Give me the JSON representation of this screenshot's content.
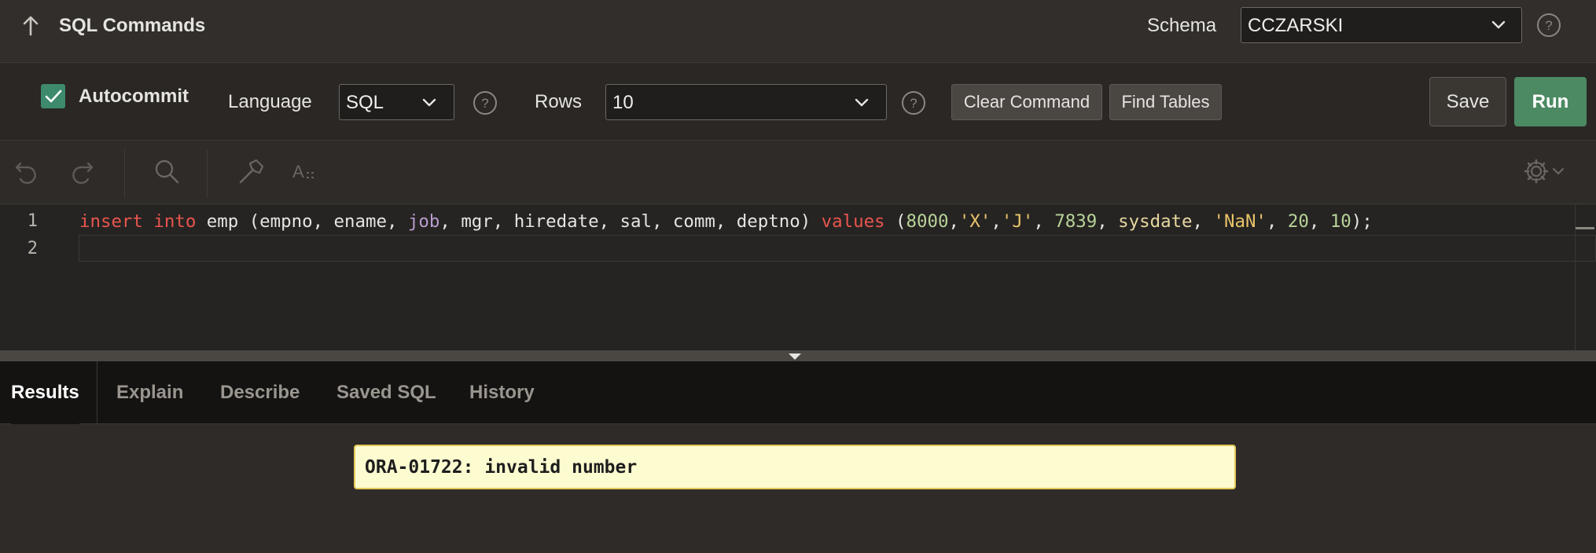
{
  "header": {
    "title": "SQL Commands",
    "schema_label": "Schema",
    "schema_value": "CCZARSKI"
  },
  "toolbar": {
    "autocommit_label": "Autocommit",
    "autocommit_checked": true,
    "language_label": "Language",
    "language_value": "SQL",
    "rows_label": "Rows",
    "rows_value": "10",
    "clear_label": "Clear Command",
    "find_tables_label": "Find Tables",
    "save_label": "Save",
    "run_label": "Run"
  },
  "editor_toolbar": {
    "icons": [
      "undo-icon",
      "redo-icon",
      "search-icon",
      "hammer-icon",
      "text-format-icon",
      "gear-icon"
    ]
  },
  "editor": {
    "line_numbers": [
      "1",
      "2"
    ],
    "tokens": [
      {
        "t": "insert",
        "c": "kw"
      },
      {
        "t": " ",
        "c": ""
      },
      {
        "t": "into",
        "c": "kw"
      },
      {
        "t": " emp (empno, ename, ",
        "c": ""
      },
      {
        "t": "job",
        "c": "fn"
      },
      {
        "t": ", mgr, hiredate, sal, comm, deptno) ",
        "c": ""
      },
      {
        "t": "values",
        "c": "kw"
      },
      {
        "t": " (",
        "c": ""
      },
      {
        "t": "8000",
        "c": "num"
      },
      {
        "t": ",",
        "c": ""
      },
      {
        "t": "'X'",
        "c": "str"
      },
      {
        "t": ",",
        "c": ""
      },
      {
        "t": "'J'",
        "c": "str"
      },
      {
        "t": ", ",
        "c": ""
      },
      {
        "t": "7839",
        "c": "num"
      },
      {
        "t": ", ",
        "c": ""
      },
      {
        "t": "sysdate",
        "c": "sysfn"
      },
      {
        "t": ", ",
        "c": ""
      },
      {
        "t": "'NaN'",
        "c": "str"
      },
      {
        "t": ", ",
        "c": ""
      },
      {
        "t": "20",
        "c": "num"
      },
      {
        "t": ", ",
        "c": ""
      },
      {
        "t": "10",
        "c": "num"
      },
      {
        "t": ");",
        "c": ""
      }
    ]
  },
  "tabs": [
    {
      "label": "Results",
      "active": true
    },
    {
      "label": "Explain",
      "active": false
    },
    {
      "label": "Describe",
      "active": false
    },
    {
      "label": "Saved SQL",
      "active": false
    },
    {
      "label": "History",
      "active": false
    }
  ],
  "results": {
    "error_message": "ORA-01722: invalid number"
  },
  "colors": {
    "run_button": "#4b8a62",
    "error_background": "#fdfcd0",
    "keyword": "#e8554e",
    "string": "#e9c46a",
    "number": "#b8d39a"
  }
}
